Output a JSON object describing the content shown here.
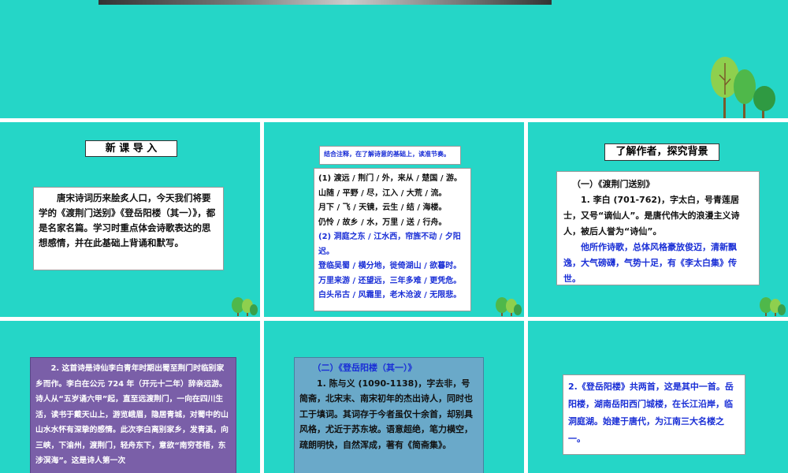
{
  "slides": {
    "s1": {},
    "s2": {
      "title": "新 课 导 入",
      "body": "唐宋诗词历来脍炙人口，今天我们将要学的《渡荆门送别》《登岳阳楼（其一）》，都是名家名篇。学习时重点体会诗歌表达的思想感情，并在此基础上背诵和默写。"
    },
    "s3": {
      "note": "结合注释，在了解诗意的基础上，读准节奏。",
      "lines_black": [
        "(1) 渡远 / 荆门 / 外，来从 / 楚国 / 游。",
        "山随 / 平野 / 尽，江入 / 大荒 / 流。",
        "月下 / 飞 / 天镜，云生 / 结 / 海楼。",
        "仍怜 / 故乡 / 水，万里 / 送 / 行舟。"
      ],
      "lines_blue": [
        "(2) 洞庭之东 / 江水西，帘旌不动 / 夕阳迟。",
        "登临吴蜀 / 横分地，徙倚湖山 / 欲暮时。",
        "万里来游 / 还望远，三年多难 / 更凭危。",
        "白头吊古 / 风霜里，老木沧波 / 无限悲。"
      ]
    },
    "s4": {
      "title": "了解作者，探究背景",
      "heading": "（一）《渡荆门送别》",
      "para1": "1. 李白 (701-762)，字太白，号青莲居士，又号“谪仙人”。是唐代伟大的浪漫主义诗人，被后人誉为“诗仙”。",
      "para2": "他所作诗歌，总体风格豪放俊迈，清新飘逸，大气磅礴，气势十足，有《李太白集》传世。"
    },
    "s5": {
      "body": "2. 这首诗是诗仙李白青年时期出蜀至荆门时临别家乡而作。李白在公元 724 年（开元十二年）辞亲远游。诗人从“五岁诵六甲”起，直至远渡荆门，一向在四川生活，读书于戴天山上，游览峨眉，隐居青城，对蜀中的山山水水怀有深挚的感情。此次李白离别家乡，发青溪，向三峡，下渝州，渡荆门，轻舟东下，意欲“南穷苍梧，东涉溟海”。这是诗人第一次"
    },
    "s6": {
      "heading": "（二）《登岳阳楼（其一）》",
      "body": "1. 陈与义 (1090-1138)，字去非，号简斋，北宋末、南宋初年的杰出诗人，同时也工于填词。其词存于今者虽仅十余首，却别具风格，尤近于苏东坡。语意超绝，笔力横空，疏朗明快，自然浑成，著有《简斋集》。"
    },
    "s7": {
      "body": "2.《登岳阳楼》共两首，这是其中一首。岳阳楼，湖南岳阳西门城楼，在长江沿岸，临洞庭湖。始建于唐代，为江南三大名楼之一。"
    },
    "colors": {
      "slide_bg": "#25d6c7",
      "blue_text": "#1a2fd6",
      "purple_box": "#7a5fa8",
      "blue_box": "#6aa9c9"
    }
  }
}
